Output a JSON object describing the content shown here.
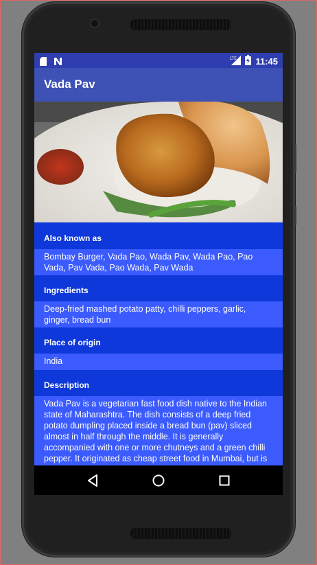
{
  "status_bar": {
    "time": "11:45",
    "icons": [
      "sd-card-icon",
      "n-notification-icon",
      "lte-signal-icon",
      "battery-icon"
    ],
    "network": "LTE"
  },
  "app_bar": {
    "title": "Vada Pav"
  },
  "hero_image": {
    "alt": "Vada Pav"
  },
  "sections": {
    "also_known_as": {
      "title": "Also known as",
      "body": "Bombay Burger, Vada Pao, Wada Pav, Wada Pao, Pao Vada, Pav Vada, Pao Wada, Pav Wada"
    },
    "ingredients": {
      "title": "Ingredients",
      "body": "Deep-fried mashed potato patty, chilli peppers, garlic, ginger, bread bun"
    },
    "place_of_origin": {
      "title": "Place of origin",
      "body": "India"
    },
    "description": {
      "title": "Description",
      "body": "Vada Pav is a vegetarian fast food dish native to the Indian state of Maharashtra. The dish consists of a deep fried potato dumpling placed inside a bread bun (pav) sliced almost in half through the middle. It is generally accompanied with one or more chutneys and a green chilli pepper. It originated as cheap street food in Mumbai, but is now served in food stalls and restaurants across India. It is also called Bombay Burger"
    }
  },
  "nav_bar": {
    "buttons": [
      "back-icon",
      "home-icon",
      "recents-icon"
    ]
  },
  "colors": {
    "status_bar": "#2e3eb0",
    "app_bar": "#3e51b5",
    "section_title_bg": "#0e38d9",
    "section_body_bg": "#3b5bff",
    "nav_bar": "#000000"
  }
}
